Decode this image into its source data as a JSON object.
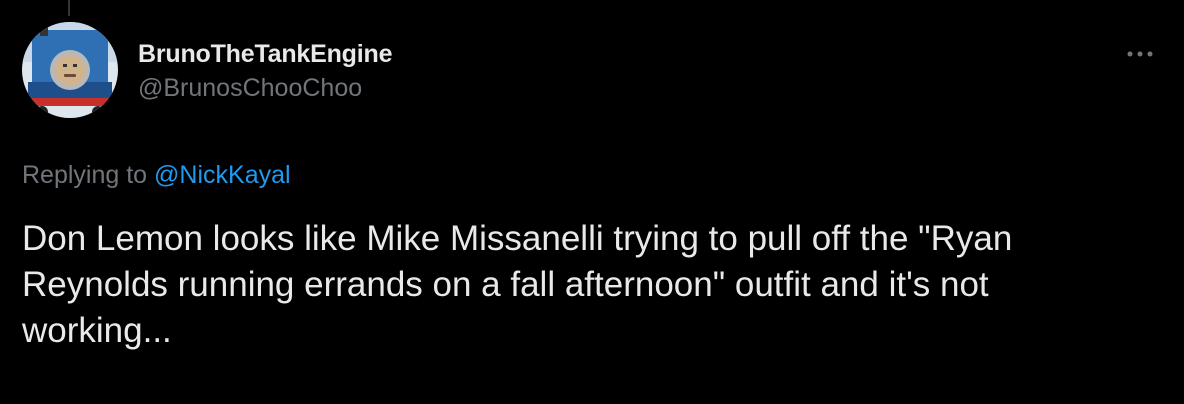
{
  "tweet": {
    "display_name": "BrunoTheTankEngine",
    "handle": "@BrunosChooChoo",
    "replying_prefix": "Replying to ",
    "replying_mention": "@NickKayal",
    "text": "Don Lemon looks like Mike Missanelli trying to pull off the \"Ryan Reynolds running errands on a fall afternoon\" outfit and it's not working..."
  },
  "icons": {
    "more": "more-horizontal-icon",
    "avatar": "avatar-image"
  },
  "colors": {
    "background": "#000000",
    "text_primary": "#e7e9ea",
    "text_secondary": "#71767b",
    "accent": "#1d9bf0"
  }
}
